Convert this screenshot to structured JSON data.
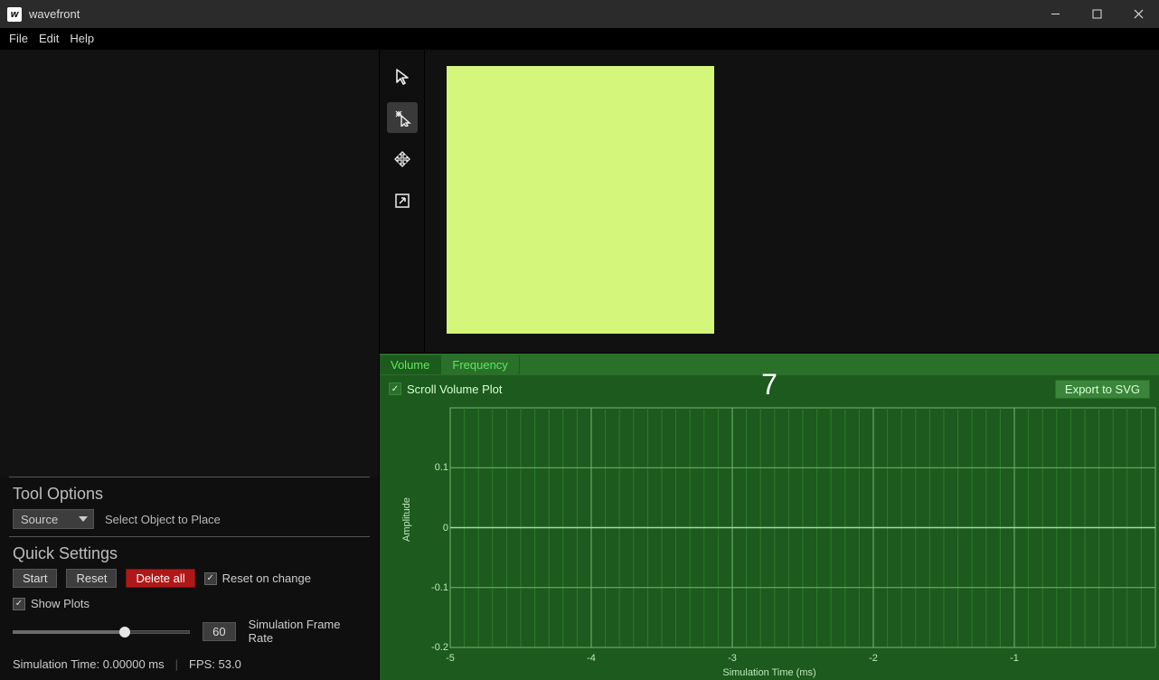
{
  "window": {
    "title": "wavefront"
  },
  "menu": {
    "items": [
      "File",
      "Edit",
      "Help"
    ]
  },
  "toolstrip": {
    "tools": [
      {
        "name": "pointer",
        "active": false
      },
      {
        "name": "place",
        "active": true
      },
      {
        "name": "move",
        "active": false
      },
      {
        "name": "resize",
        "active": false
      }
    ]
  },
  "sidebar": {
    "tool_options": {
      "title": "Tool Options",
      "dropdown_value": "Source",
      "hint": "Select Object to Place"
    },
    "quick_settings": {
      "title": "Quick Settings",
      "start": "Start",
      "reset": "Reset",
      "delete_all": "Delete all",
      "reset_on_change": "Reset on change",
      "show_plots": "Show Plots",
      "frame_rate_value": "60",
      "frame_rate_label": "Simulation Frame Rate",
      "slider_percent": 63
    },
    "status": {
      "sim_time": "Simulation Time: 0.00000 ms",
      "fps": "FPS: 53.0"
    }
  },
  "plot": {
    "tabs": [
      "Volume",
      "Frequency"
    ],
    "active_tab": 0,
    "scroll_label": "Scroll Volume Plot",
    "scroll_checked": true,
    "export_label": "Export to SVG",
    "overlay_number": "7"
  },
  "chart_data": {
    "type": "line",
    "title": "",
    "xlabel": "Simulation Time (ms)",
    "ylabel": "Amplitude",
    "xlim": [
      -5,
      0
    ],
    "ylim": [
      -0.2,
      0.2
    ],
    "xticks": [
      -5,
      -4,
      -3,
      -2,
      -1
    ],
    "yticks": [
      -0.2,
      -0.1,
      0,
      0.1
    ],
    "series": [
      {
        "name": "amplitude",
        "values": []
      }
    ]
  },
  "colors": {
    "sim_square": "#d4f67a",
    "plot_bg": "#1d5a1d",
    "plot_accent": "#5fe85f"
  }
}
